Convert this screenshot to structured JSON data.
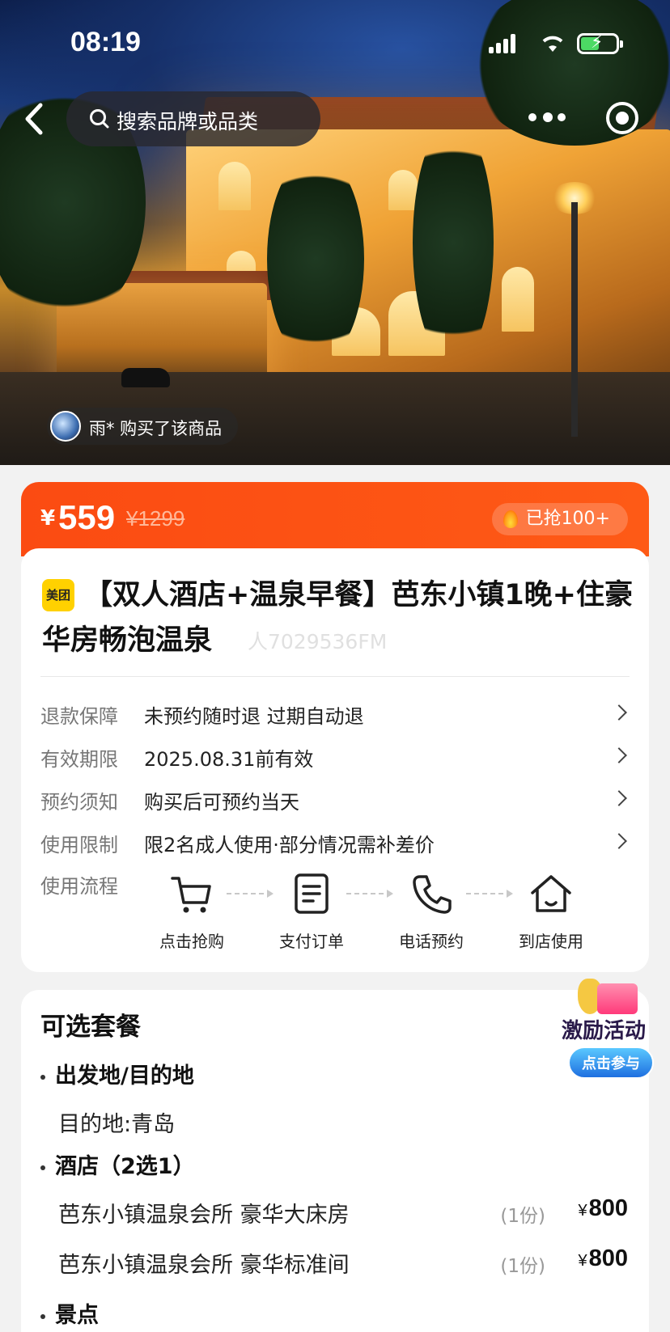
{
  "status": {
    "time": "08:19"
  },
  "nav": {
    "search_placeholder": "搜索品牌或品类"
  },
  "hero": {
    "buyer_text": "雨* 购买了该商品"
  },
  "price": {
    "currency": "¥",
    "current": "559",
    "original": "¥1299",
    "sold": "已抢100+"
  },
  "product": {
    "brand_logo": "美团",
    "title": "【双人酒店+温泉早餐】芭东小镇1晚+住豪华房畅泡温泉",
    "watermark": "人7029536FM"
  },
  "info_rows": [
    {
      "label": "退款保障",
      "value": "未预约随时退 过期自动退"
    },
    {
      "label": "有效期限",
      "value": "2025.08.31前有效"
    },
    {
      "label": "预约须知",
      "value": "购买后可预约当天"
    },
    {
      "label": "使用限制",
      "value": "限2名成人使用·部分情况需补差价"
    }
  ],
  "flow": {
    "label": "使用流程",
    "steps": [
      {
        "label": "点击抢购",
        "icon": "cart-icon"
      },
      {
        "label": "支付订单",
        "icon": "document-icon"
      },
      {
        "label": "电话预约",
        "icon": "phone-icon"
      },
      {
        "label": "到店使用",
        "icon": "home-icon"
      }
    ]
  },
  "packages": {
    "heading": "可选套餐",
    "sections": [
      {
        "title": "出发地/目的地",
        "items": [
          {
            "name": "目的地:青岛"
          }
        ]
      },
      {
        "title": "酒店（2选1）",
        "items": [
          {
            "name": "芭东小镇温泉会所 豪华大床房",
            "qty": "(1份)",
            "currency": "¥",
            "price": "800"
          },
          {
            "name": "芭东小镇温泉会所 豪华标准间",
            "qty": "(1份)",
            "currency": "¥",
            "price": "800"
          }
        ]
      },
      {
        "title": "景点"
      }
    ]
  },
  "promo": {
    "title": "激励活动",
    "button": "点击参与"
  },
  "colors": {
    "accent": "#fe5a16",
    "brand_yellow": "#ffd100"
  }
}
